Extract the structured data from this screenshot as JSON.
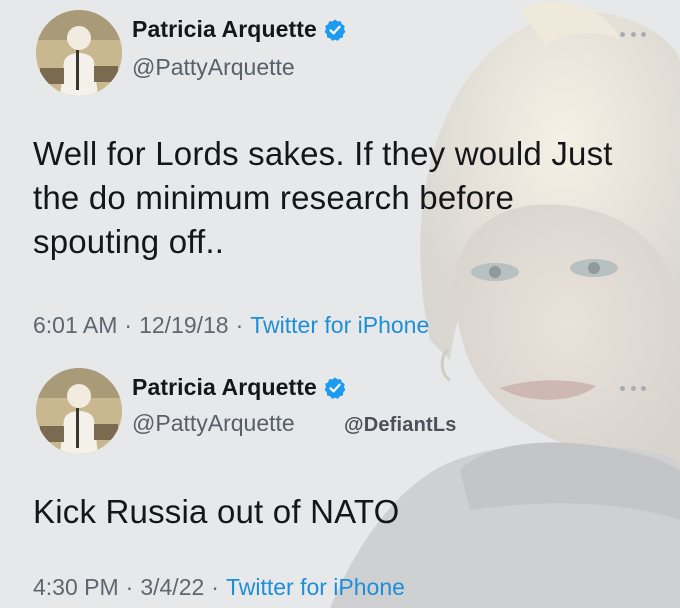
{
  "tweets": [
    {
      "display_name": "Patricia Arquette",
      "handle": "@PattyArquette",
      "text": "Well for Lords sakes. If they would Just the do minimum research before spouting off..",
      "time": "6:01 AM",
      "date": "12/19/18",
      "source": "Twitter for iPhone"
    },
    {
      "display_name": "Patricia Arquette",
      "handle": "@PattyArquette",
      "watermark": "@DefiantLs",
      "text": "Kick Russia out of NATO",
      "time": "4:30 PM",
      "date": "3/4/22",
      "source": "Twitter for iPhone"
    }
  ],
  "separator": "·",
  "icons": {
    "verified": "verified-badge-icon",
    "more": "more-options-icon"
  },
  "colors": {
    "verified_blue": "#1d9bf0",
    "link_blue": "#1d8fd8",
    "background": "#e7e8ea"
  }
}
